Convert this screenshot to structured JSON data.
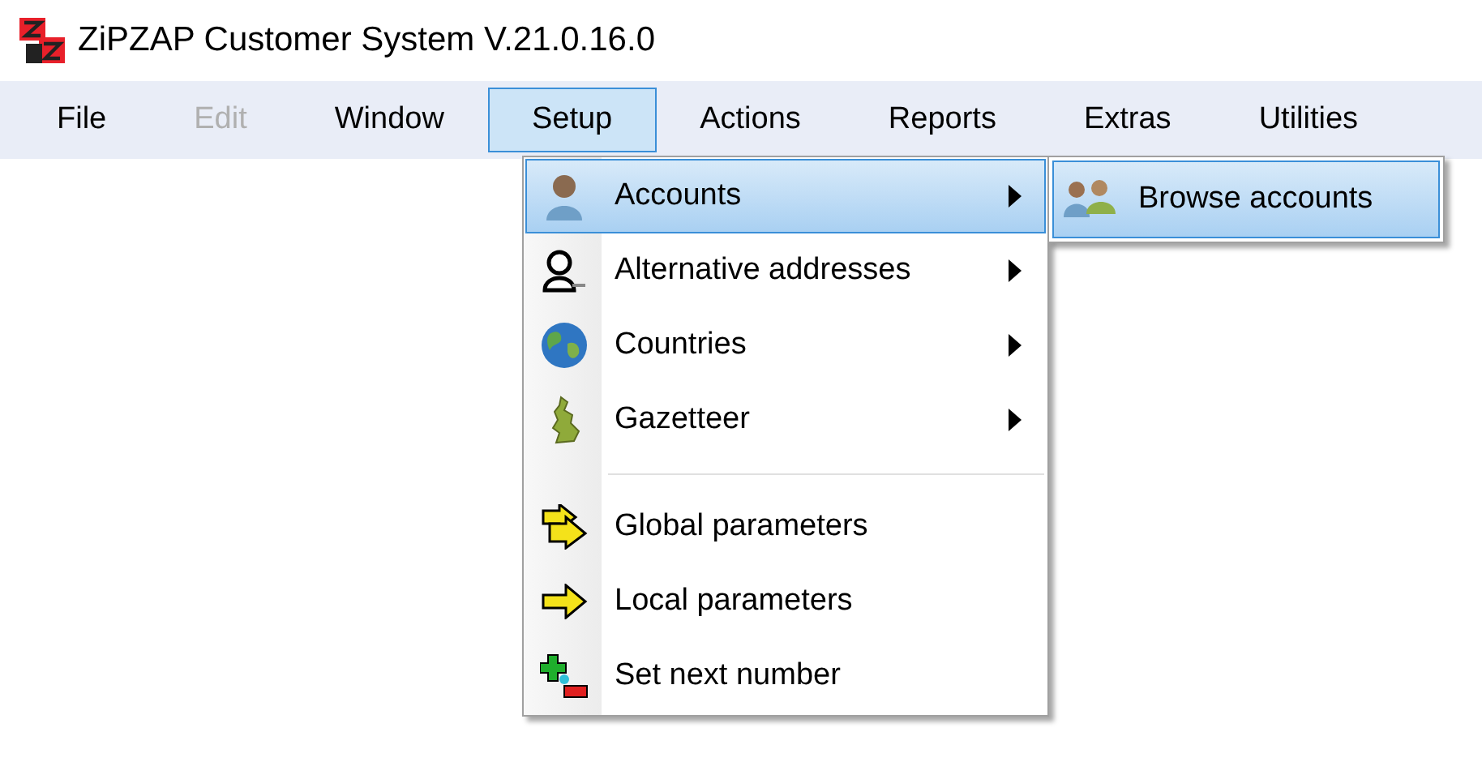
{
  "window": {
    "title": "ZiPZAP Customer System V.21.0.16.0"
  },
  "menu_bar": [
    {
      "label": "File",
      "disabled": false,
      "selected": false
    },
    {
      "label": "Edit",
      "disabled": true,
      "selected": false
    },
    {
      "label": "Window",
      "disabled": false,
      "selected": false
    },
    {
      "label": "Setup",
      "disabled": false,
      "selected": true
    },
    {
      "label": "Actions",
      "disabled": false,
      "selected": false
    },
    {
      "label": "Reports",
      "disabled": false,
      "selected": false
    },
    {
      "label": "Extras",
      "disabled": false,
      "selected": false
    },
    {
      "label": "Utilities",
      "disabled": false,
      "selected": false
    }
  ],
  "setup_menu": [
    {
      "kind": "item",
      "label": "Accounts",
      "submenu": true,
      "selected": true
    },
    {
      "kind": "item",
      "label": "Alternative addresses",
      "submenu": true,
      "selected": false
    },
    {
      "kind": "item",
      "label": "Countries",
      "submenu": true,
      "selected": false
    },
    {
      "kind": "item",
      "label": "Gazetteer",
      "submenu": true,
      "selected": false
    },
    {
      "kind": "separator"
    },
    {
      "kind": "item",
      "label": "Global parameters",
      "submenu": false,
      "selected": false
    },
    {
      "kind": "item",
      "label": "Local parameters",
      "submenu": false,
      "selected": false
    },
    {
      "kind": "item",
      "label": "Set next number",
      "submenu": false,
      "selected": false
    }
  ],
  "accounts_submenu": [
    {
      "label": "Browse accounts",
      "selected": true
    }
  ]
}
